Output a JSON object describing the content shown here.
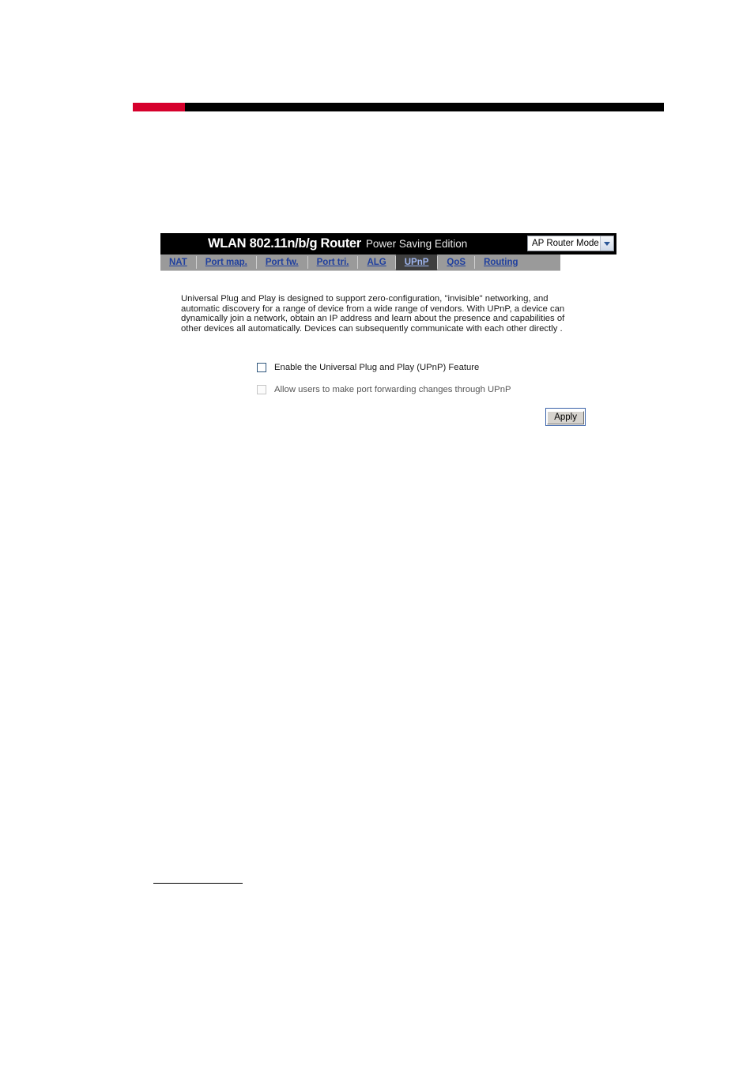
{
  "page": {
    "accent_red": "#d6002c",
    "accent_black": "#000000"
  },
  "router": {
    "header": {
      "title": "WLAN 802.11n/b/g Router",
      "subtitle": "Power Saving Edition",
      "mode_select": {
        "selected": "AP Router Mode",
        "arrow_icon": "chevron-down-icon"
      }
    },
    "tabs": [
      {
        "label": "NAT",
        "active": false
      },
      {
        "label": "Port map.",
        "active": false
      },
      {
        "label": "Port fw.",
        "active": false
      },
      {
        "label": "Port tri.",
        "active": false
      },
      {
        "label": "ALG",
        "active": false
      },
      {
        "label": "UPnP",
        "active": true
      },
      {
        "label": "QoS",
        "active": false
      },
      {
        "label": "Routing",
        "active": false
      }
    ],
    "description": "Universal Plug and Play is designed to support zero-configuration, \"invisible\" networking, and automatic discovery for a range of device from a wide range of vendors. With UPnP, a device can dynamically join a network, obtain an IP address and learn about the presence and capabilities of other devices all automatically. Devices can subsequently communicate with each other directly .",
    "options": [
      {
        "label": "Enable the Universal Plug and Play (UPnP) Feature",
        "checked": false,
        "disabled": false
      },
      {
        "label": "Allow users to make port forwarding changes through UPnP",
        "checked": false,
        "disabled": true
      }
    ],
    "apply_label": "Apply"
  }
}
